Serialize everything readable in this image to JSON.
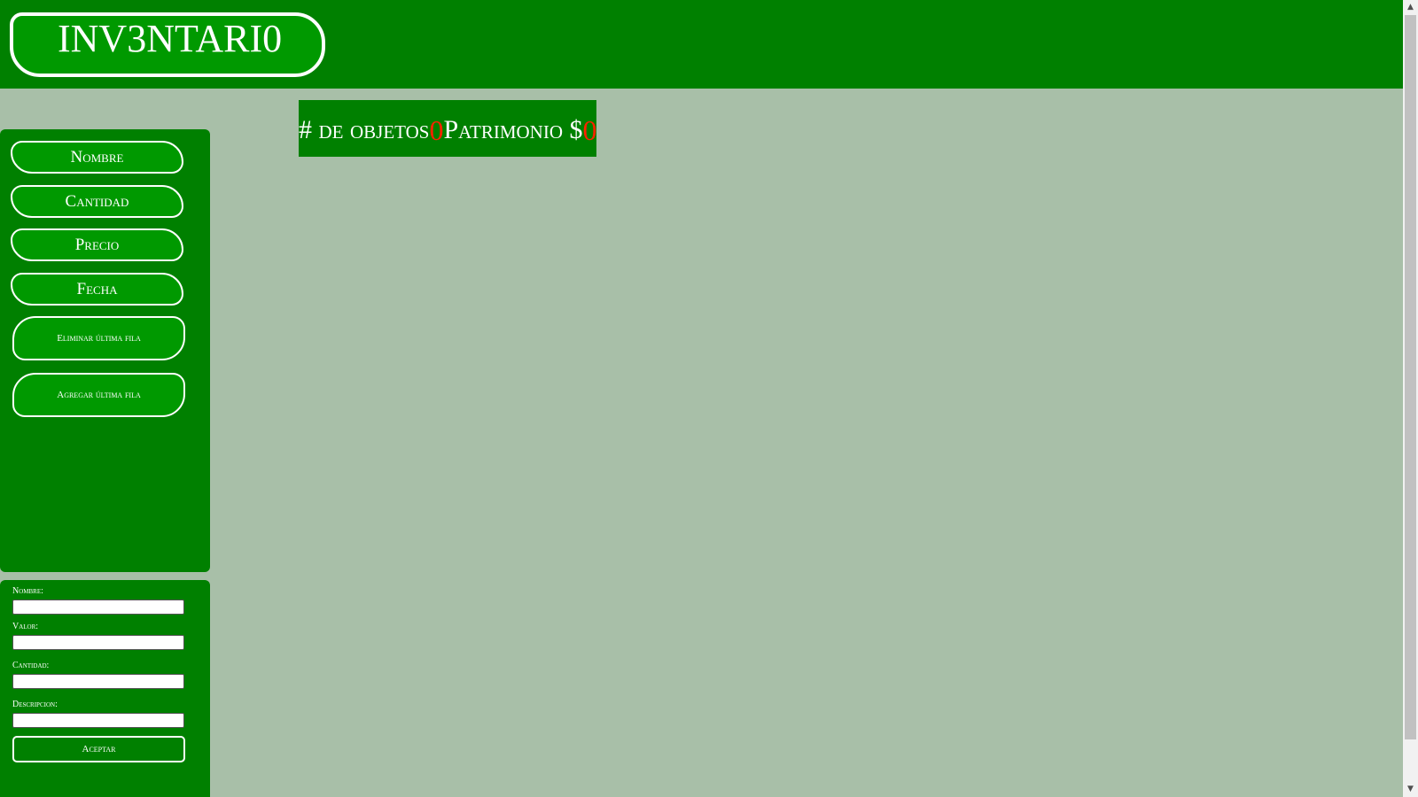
{
  "header": {
    "logo_text": "INV3NTARI0",
    "background_color": "#008000"
  },
  "sidebar": {
    "sort_buttons": [
      "Nombre",
      "Cantidad",
      "Precio",
      "Fecha"
    ],
    "remove_row_label": "Eliminar última fila",
    "add_row_label": "Agregar última fila"
  },
  "form": {
    "fields": [
      {
        "label": "Nombre:",
        "value": ""
      },
      {
        "label": "Valor:",
        "value": ""
      },
      {
        "label": "Cantidad:",
        "value": ""
      },
      {
        "label": "Descripcion:",
        "value": ""
      }
    ],
    "submit_label": "Aceptar"
  },
  "stats": {
    "objects_label": "# de objetos",
    "objects_count": "0",
    "patrimony_label": "Patrimonio $",
    "patrimony_value": "0",
    "count_color": "#ff2200"
  },
  "colors": {
    "page_background": "#a8bfa8",
    "panel_green": "#008000",
    "button_green": "#009900"
  }
}
